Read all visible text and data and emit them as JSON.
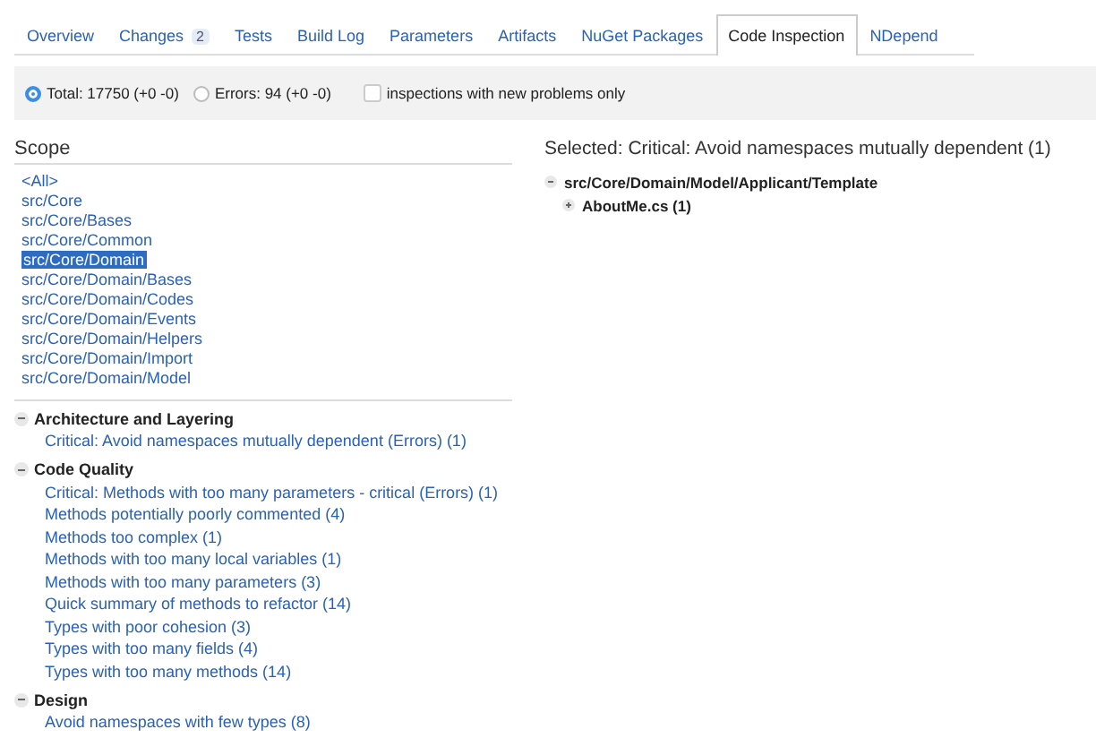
{
  "tabs": [
    {
      "label": "Overview",
      "selected": false
    },
    {
      "label": "Changes",
      "badge": "2",
      "selected": false
    },
    {
      "label": "Tests",
      "selected": false
    },
    {
      "label": "Build Log",
      "selected": false
    },
    {
      "label": "Parameters",
      "selected": false
    },
    {
      "label": "Artifacts",
      "selected": false
    },
    {
      "label": "NuGet Packages",
      "selected": false
    },
    {
      "label": "Code Inspection",
      "selected": true
    },
    {
      "label": "NDepend",
      "selected": false
    }
  ],
  "filter": {
    "radios": [
      {
        "label": "Total: 17750 (+0 -0)",
        "selected": true
      },
      {
        "label": "Errors: 94 (+0 -0)",
        "selected": false
      }
    ],
    "checkbox": {
      "label": "inspections with new problems only",
      "checked": false
    }
  },
  "scope": {
    "title": "Scope",
    "items": [
      {
        "label": "<All>",
        "selected": false
      },
      {
        "label": "src/Core",
        "selected": false
      },
      {
        "label": "src/Core/Bases",
        "selected": false
      },
      {
        "label": "src/Core/Common",
        "selected": false
      },
      {
        "label": "src/Core/Domain",
        "selected": true
      },
      {
        "label": "src/Core/Domain/Bases",
        "selected": false
      },
      {
        "label": "src/Core/Domain/Codes",
        "selected": false
      },
      {
        "label": "src/Core/Domain/Events",
        "selected": false
      },
      {
        "label": "src/Core/Domain/Helpers",
        "selected": false
      },
      {
        "label": "src/Core/Domain/Import",
        "selected": false
      },
      {
        "label": "src/Core/Domain/Model",
        "selected": false
      }
    ]
  },
  "inspections": [
    {
      "category": "Architecture and Layering",
      "expanded": true,
      "items": [
        "Critical: Avoid namespaces mutually dependent (Errors) (1)"
      ]
    },
    {
      "category": "Code Quality",
      "expanded": true,
      "items": [
        "Critical: Methods with too many parameters - critical (Errors) (1)",
        "Methods potentially poorly commented (4)",
        "Methods too complex (1)",
        "Methods with too many local variables (1)",
        "Methods with too many parameters (3)",
        "Quick summary of methods to refactor (14)",
        "Types with poor cohesion (3)",
        "Types with too many fields (4)",
        "Types with too many methods (14)"
      ]
    },
    {
      "category": "Design",
      "expanded": true,
      "items": [
        "Avoid namespaces with few types (8)"
      ]
    }
  ],
  "selected_panel": {
    "title": "Selected: Critical: Avoid namespaces mutually dependent (1)",
    "tree": [
      {
        "label": "src/Core/Domain/Model/Applicant/Template",
        "expanded": true,
        "children": [
          {
            "label": "AboutMe.cs (1)",
            "expanded": false
          }
        ]
      }
    ]
  }
}
